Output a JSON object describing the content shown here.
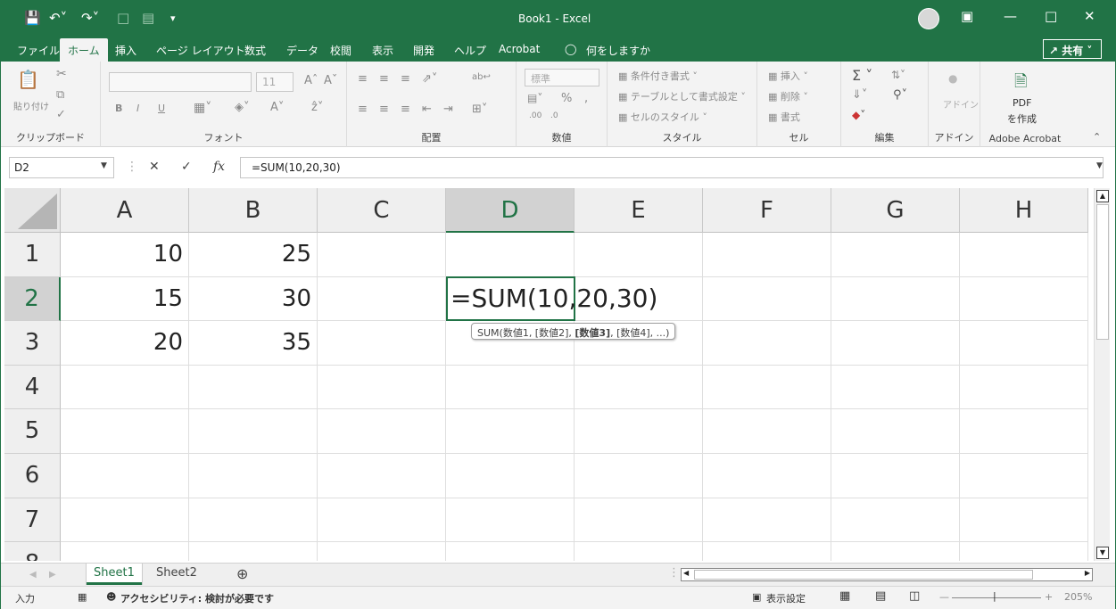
{
  "window": {
    "title": "Book1 - Excel"
  },
  "quick_access": {
    "save_icon": "save-icon",
    "undo_icon": "undo-icon",
    "redo_icon": "redo-icon"
  },
  "tabs": [
    "ファイル",
    "ホーム",
    "挿入",
    "ページ レイアウト",
    "数式",
    "データ",
    "校閲",
    "表示",
    "開発",
    "ヘルプ",
    "Acrobat",
    "何をしますか"
  ],
  "active_tab": "ホーム",
  "share_label": "共有",
  "ribbon": {
    "clipboard": {
      "label": "クリップボード",
      "paste": "貼り付け"
    },
    "font": {
      "label": "フォント",
      "size": "11",
      "bold": "B",
      "italic": "I",
      "underline": "U"
    },
    "alignment": {
      "label": "配置"
    },
    "number": {
      "label": "数値",
      "format": "標準"
    },
    "styles": {
      "label": "スタイル",
      "items": [
        "条件付き書式",
        "テーブルとして書式設定",
        "セルのスタイル"
      ]
    },
    "cells": {
      "label": "セル",
      "items": [
        "挿入",
        "削除",
        "書式"
      ]
    },
    "editing": {
      "label": "編集"
    },
    "addin": {
      "label": "アドイン",
      "button": "アドイン"
    },
    "acrobat": {
      "label": "Adobe Acrobat",
      "pdf": "PDF",
      "create": "を作成"
    }
  },
  "formula_bar": {
    "name_box": "D2",
    "formula": "=SUM(10,20,30)",
    "fx": "fx"
  },
  "grid": {
    "columns": [
      "A",
      "B",
      "C",
      "D",
      "E",
      "F",
      "G",
      "H"
    ],
    "rows": [
      "1",
      "2",
      "3",
      "4",
      "5",
      "6",
      "7",
      "8"
    ],
    "selected_column": "D",
    "selected_row": "2",
    "cells": {
      "A1": "10",
      "B1": "25",
      "A2": "15",
      "B2": "30",
      "A3": "20",
      "B3": "35"
    },
    "editing_text": "=SUM(10,20,30)",
    "tooltip": {
      "prefix": "SUM(数値1, [数値2], ",
      "bold": "[数値3]",
      "suffix": ", [数値4], ...)"
    }
  },
  "sheets": [
    "Sheet1",
    "Sheet2"
  ],
  "active_sheet": "Sheet1",
  "status": {
    "mode": "入力",
    "accessibility": "アクセシビリティ: 検討が必要です",
    "display_settings": "表示設定",
    "zoom": "205%"
  },
  "colors": {
    "accent": "#217346"
  }
}
